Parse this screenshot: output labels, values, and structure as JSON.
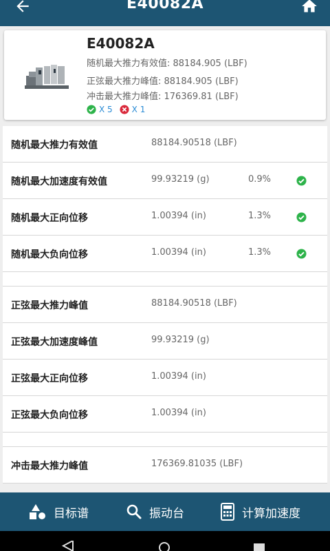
{
  "header": {
    "title": "E40082A"
  },
  "summary": {
    "name": "E40082A",
    "random_force": "随机最大推力有效值: 88184.905 (LBF)",
    "sine_force": "正弦最大推力峰值: 88184.905 (LBF)",
    "shock_force": "冲击最大推力峰值: 176369.81 (LBF)",
    "pass_count": "X 5",
    "fail_count": "X 1"
  },
  "rows_random": [
    {
      "label": "随机最大推力有效值",
      "value": "88184.90518 (LBF)",
      "pct": "",
      "ok": false
    },
    {
      "label": "随机最大加速度有效值",
      "value": "99.93219 (g)",
      "pct": "0.9%",
      "ok": true
    },
    {
      "label": "随机最大正向位移",
      "value": "1.00394 (in)",
      "pct": "1.3%",
      "ok": true
    },
    {
      "label": "随机最大负向位移",
      "value": "1.00394 (in)",
      "pct": "1.3%",
      "ok": true
    }
  ],
  "rows_sine": [
    {
      "label": "正弦最大推力峰值",
      "value": "88184.90518 (LBF)"
    },
    {
      "label": "正弦最大加速度峰值",
      "value": "99.93219 (g)"
    },
    {
      "label": "正弦最大正向位移",
      "value": "1.00394 (in)"
    },
    {
      "label": "正弦最大负向位移",
      "value": "1.00394 (in)"
    }
  ],
  "rows_shock": [
    {
      "label": "冲击最大推力峰值",
      "value": "176369.81035 (LBF)"
    }
  ],
  "bottom_nav": {
    "target": "目标谱",
    "shaker": "振动台",
    "calc": "计算加速度"
  },
  "colors": {
    "primary": "#1d5573",
    "ok": "#2db34a",
    "fail": "#d9283a",
    "link": "#2a8bd5"
  }
}
